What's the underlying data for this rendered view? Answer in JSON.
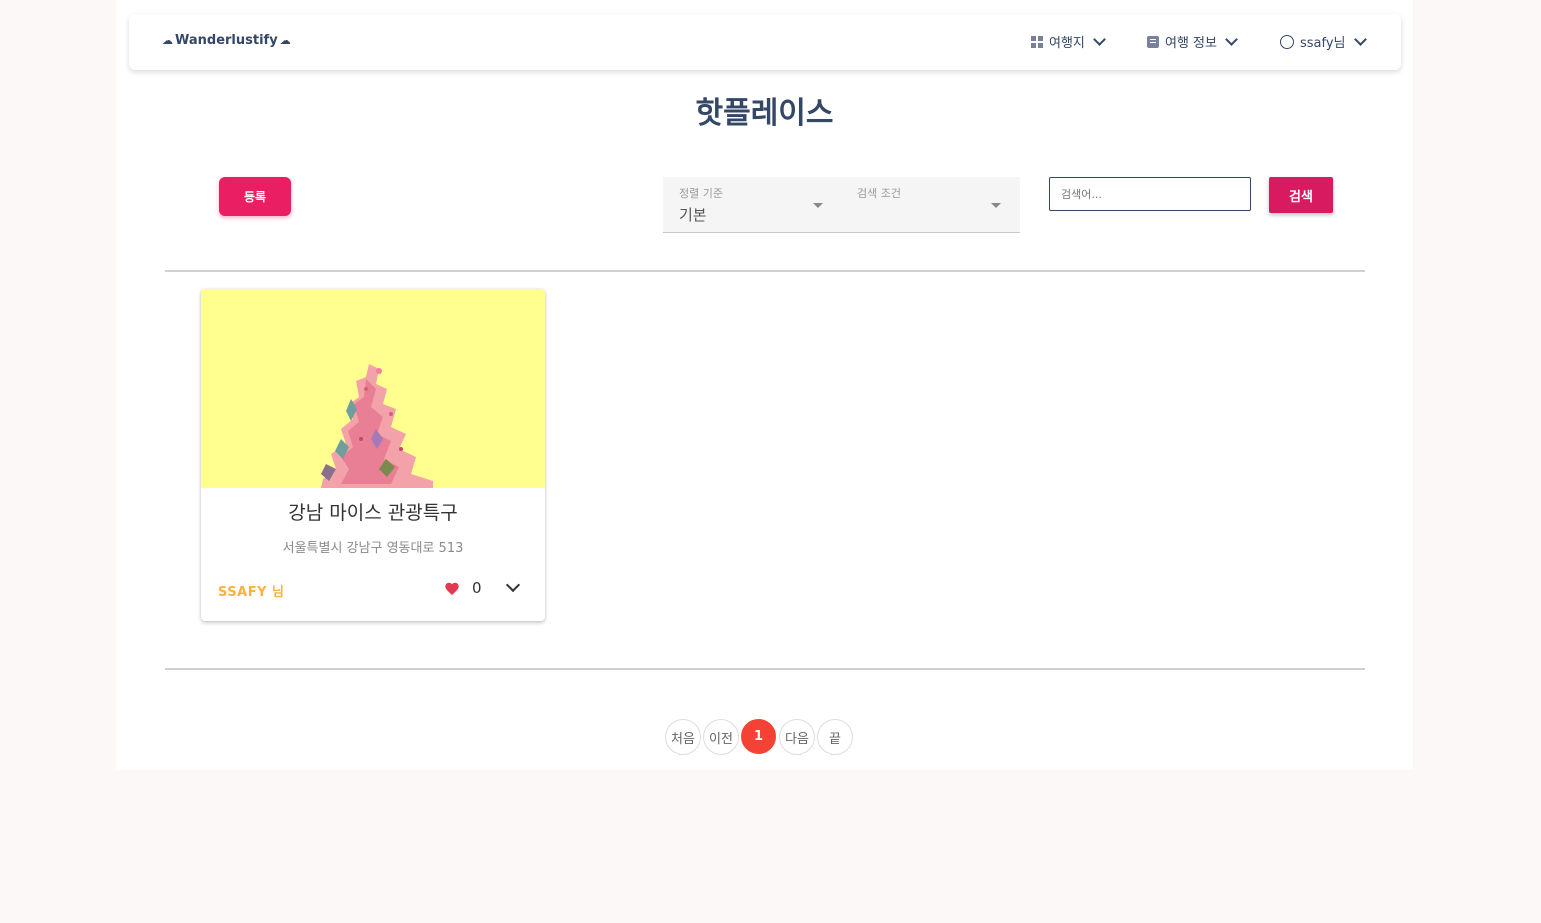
{
  "brand": {
    "name": "Wanderlustify",
    "left_icon": "cloud-icon",
    "right_icon": "cloud-icon"
  },
  "nav": {
    "items": [
      {
        "label": "여행지",
        "icon": "dashboard-icon"
      },
      {
        "label": "여행 정보",
        "icon": "article-icon"
      },
      {
        "label": "ssafy님",
        "icon": "face-icon"
      }
    ]
  },
  "page_title": "핫플레이스",
  "toolbar": {
    "register_label": "등록",
    "sort": {
      "label": "정렬 기준",
      "value": "기본"
    },
    "condition": {
      "label": "검색 조건",
      "value": ""
    },
    "search_placeholder": "검색어...",
    "search_label": "검색"
  },
  "cards": [
    {
      "title": "강남 마이스 관광특구",
      "address": "서울특별시 강남구 영동대로 513",
      "user": "SSAFY 님",
      "likes": "0",
      "image_bg": "#ffff8f"
    }
  ],
  "pagination": {
    "first": "처음",
    "prev": "이전",
    "current": "1",
    "next": "다음",
    "last": "끝"
  },
  "colors": {
    "primary": "#e91e63",
    "accent_red": "#f44335",
    "text_dark": "#344767",
    "user_gold": "#fbb140"
  }
}
